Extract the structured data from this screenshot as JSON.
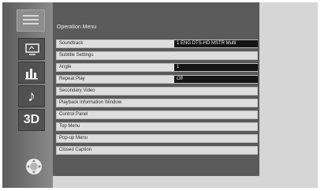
{
  "rail": {
    "tabs": [
      {
        "name": "menu-list-icon"
      },
      {
        "name": "screen-icon"
      },
      {
        "name": "equalizer-icon"
      },
      {
        "name": "music-note-icon"
      },
      {
        "name": "3d-icon",
        "label": "3D"
      }
    ]
  },
  "menu": {
    "title": "Operation Menu",
    "items": [
      {
        "label": "Soundtrack",
        "value": "1 ENG DTS-HD MSTR Multi"
      },
      {
        "label": "Subtitle Settings",
        "value": ""
      },
      {
        "label": "Angle",
        "value": "1"
      },
      {
        "label": "Repeat Play",
        "value": "Off"
      },
      {
        "label": "Secondary Video",
        "value": ""
      },
      {
        "label": "Playback Information Window",
        "value": ""
      },
      {
        "label": "Control Panel",
        "value": ""
      },
      {
        "label": "Top Menu",
        "value": ""
      },
      {
        "label": "Pop-up Menu",
        "value": ""
      },
      {
        "label": "Closed Caption",
        "value": ""
      }
    ]
  },
  "colors": {
    "panel": "#5a5a5a",
    "row": "#dedede",
    "value_field": "#141414",
    "screen_bg": "#d6d6d6"
  }
}
